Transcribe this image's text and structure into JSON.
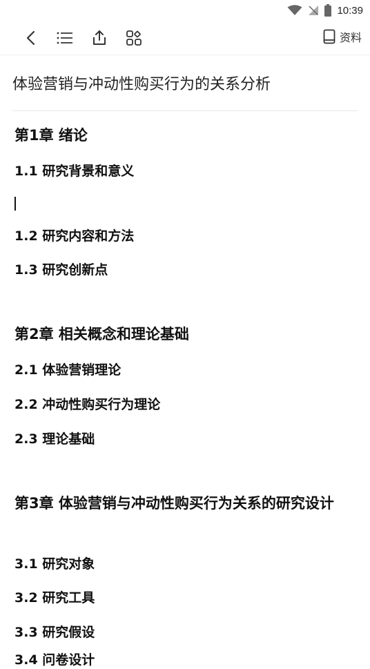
{
  "status_bar": {
    "time": "10:39"
  },
  "toolbar": {
    "resource_label": "资料"
  },
  "document": {
    "title": "体验营销与冲动性购买行为的关系分析",
    "outline": [
      {
        "type": "chapter",
        "text": "第1章 绪论"
      },
      {
        "type": "section",
        "text": "1.1 研究背景和意义"
      },
      {
        "type": "section",
        "text": "1.2 研究内容和方法"
      },
      {
        "type": "section",
        "text": "1.3 研究创新点"
      },
      {
        "type": "chapter",
        "text": "第2章 相关概念和理论基础"
      },
      {
        "type": "section",
        "text": "2.1 体验营销理论"
      },
      {
        "type": "section",
        "text": "2.2 冲动性购买行为理论"
      },
      {
        "type": "section",
        "text": "2.3 理论基础"
      },
      {
        "type": "chapter",
        "text": "第3章 体验营销与冲动性购买行为关系的研究设计"
      },
      {
        "type": "section",
        "text": "3.1 研究对象"
      },
      {
        "type": "section",
        "text": "3.2 研究工具"
      },
      {
        "type": "section",
        "text": "3.3 研究假设"
      },
      {
        "type": "section",
        "text": "3.4 问卷设计"
      }
    ]
  }
}
